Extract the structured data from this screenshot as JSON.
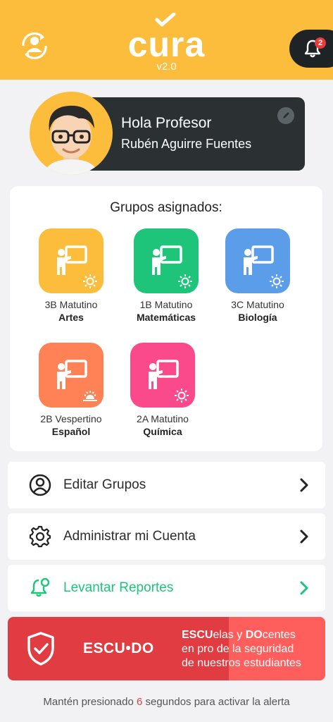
{
  "header": {
    "logo": "cura",
    "version": "v2.0",
    "notification_count": "2"
  },
  "profile": {
    "greeting": "Hola Profesor",
    "name": "Rubén Aguirre Fuentes"
  },
  "groups": {
    "title": "Grupos asignados:",
    "items": [
      {
        "shift": "3B Matutino",
        "subject": "Artes",
        "color": "#fdbd3c",
        "time_icon": "sun-icon"
      },
      {
        "shift": "1B Matutino",
        "subject": "Matemáticas",
        "color": "#1dc47a",
        "time_icon": "sun-icon"
      },
      {
        "shift": "3C Matutino",
        "subject": "Biología",
        "color": "#5b9de8",
        "time_icon": "sun-icon"
      },
      {
        "shift": "2B Vespertino",
        "subject": "Español",
        "color": "#ff8257",
        "time_icon": "sunset-icon"
      },
      {
        "shift": "2A Matutino",
        "subject": "Química",
        "color": "#fb4a8b",
        "time_icon": "sun-icon"
      }
    ]
  },
  "menu": {
    "edit_groups": "Editar Grupos",
    "manage_account": "Administrar mi Cuenta",
    "reports": "Levantar Reportes",
    "reports_color": "#1dc47a"
  },
  "escudo": {
    "name": "ESCU•DO",
    "line1_a": "ESCU",
    "line1_b": "elas y ",
    "line1_c": "DO",
    "line1_d": "centes",
    "line2": "en pro de la seguridad",
    "line3": "de nuestros estudiantes"
  },
  "hint": {
    "before": "Mantén presionado ",
    "number": "6",
    "after": " segundos para activar la alerta"
  }
}
